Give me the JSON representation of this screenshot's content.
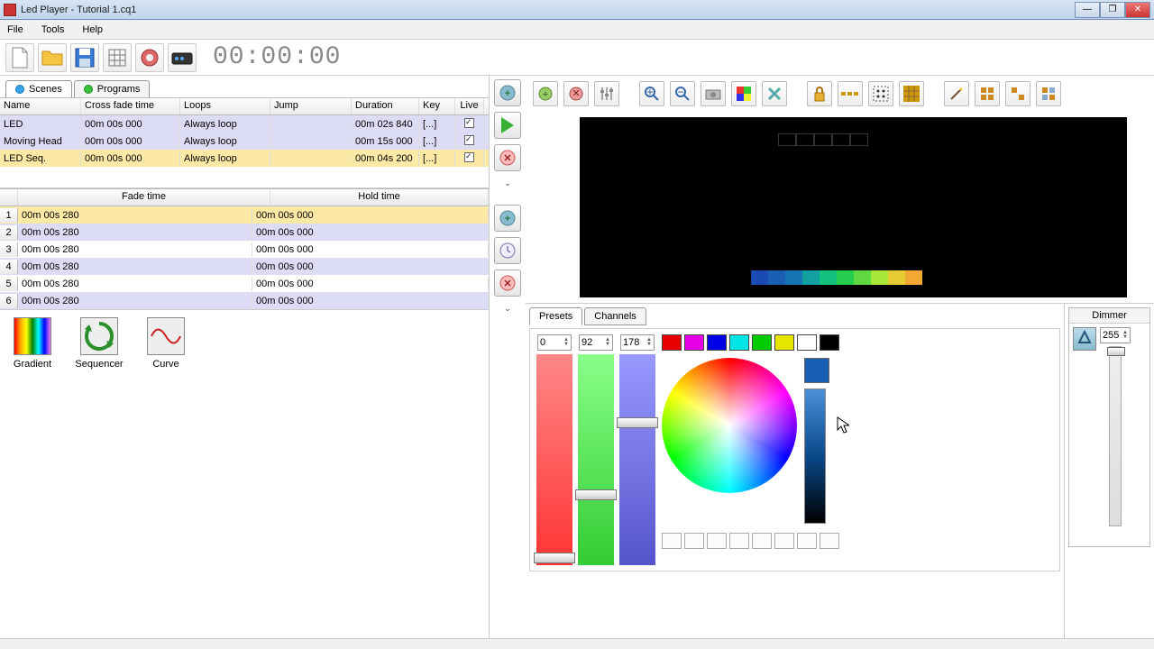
{
  "window": {
    "title": "Led Player - Tutorial 1.cq1"
  },
  "menu": {
    "file": "File",
    "tools": "Tools",
    "help": "Help"
  },
  "timer": "00:00:00",
  "tabs": {
    "scenes": "Scenes",
    "programs": "Programs"
  },
  "scene_cols": {
    "name": "Name",
    "cross": "Cross fade time",
    "loops": "Loops",
    "jump": "Jump",
    "dur": "Duration",
    "key": "Key",
    "live": "Live"
  },
  "scenes": [
    {
      "name": "LED",
      "cross": "00m 00s 000",
      "loops": "Always loop",
      "jump": "",
      "dur": "00m 02s 840",
      "key": "[...]",
      "live": true
    },
    {
      "name": "Moving Head",
      "cross": "00m 00s 000",
      "loops": "Always loop",
      "jump": "",
      "dur": "00m 15s 000",
      "key": "[...]",
      "live": true
    },
    {
      "name": "LED Seq.",
      "cross": "00m 00s 000",
      "loops": "Always loop",
      "jump": "",
      "dur": "00m 04s 200",
      "key": "[...]",
      "live": true
    }
  ],
  "step_cols": {
    "fade": "Fade time",
    "hold": "Hold time"
  },
  "steps": [
    {
      "idx": "1",
      "fade": "00m 00s 280",
      "hold": "00m 00s 000"
    },
    {
      "idx": "2",
      "fade": "00m 00s 280",
      "hold": "00m 00s 000"
    },
    {
      "idx": "3",
      "fade": "00m 00s 280",
      "hold": "00m 00s 000"
    },
    {
      "idx": "4",
      "fade": "00m 00s 280",
      "hold": "00m 00s 000"
    },
    {
      "idx": "5",
      "fade": "00m 00s 280",
      "hold": "00m 00s 000"
    },
    {
      "idx": "6",
      "fade": "00m 00s 280",
      "hold": "00m 00s 000"
    }
  ],
  "presets": {
    "gradient": "Gradient",
    "sequencer": "Sequencer",
    "curve": "Curve"
  },
  "panel_tabs": {
    "presets": "Presets",
    "channels": "Channels"
  },
  "rgb": {
    "r": "0",
    "g": "92",
    "b": "178"
  },
  "swatches": [
    "#e60000",
    "#e600e6",
    "#0000e6",
    "#00e6e6",
    "#00cc00",
    "#e6e600",
    "#ffffff",
    "#000000"
  ],
  "led_colors": [
    "#1a4ab4",
    "#1a5fb4",
    "#1676b4",
    "#13a0a0",
    "#13c080",
    "#26cc4d",
    "#5fd93f",
    "#a6e639",
    "#e6cc33",
    "#f2a933"
  ],
  "dimmer": {
    "title": "Dimmer",
    "value": "255"
  }
}
